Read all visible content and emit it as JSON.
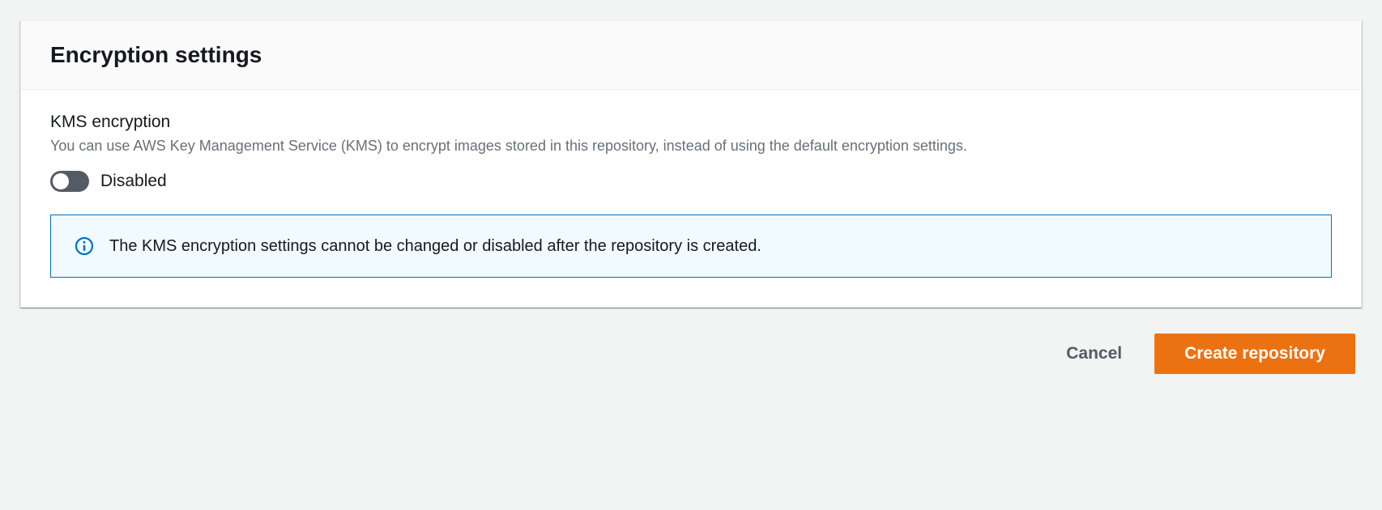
{
  "panel": {
    "title": "Encryption settings",
    "field_label": "KMS encryption",
    "field_description": "You can use AWS Key Management Service (KMS) to encrypt images stored in this repository, instead of using the default encryption settings.",
    "toggle_state": "Disabled",
    "info_text": "The KMS encryption settings cannot be changed or disabled after the repository is created."
  },
  "actions": {
    "cancel": "Cancel",
    "create": "Create repository"
  }
}
